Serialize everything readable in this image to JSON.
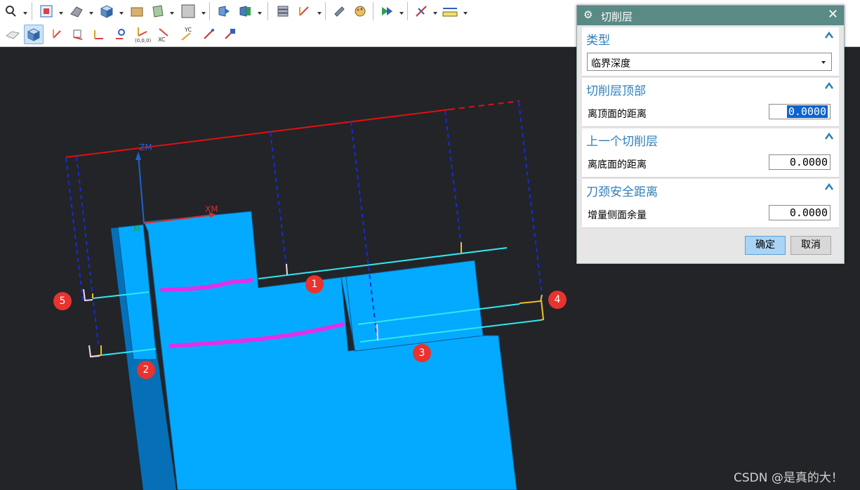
{
  "toolbar": {
    "row1_icons": [
      "magnifier-icon",
      "fit-view-icon",
      "shaded-view-icon",
      "solid-cube-icon",
      "folder-icon",
      "sheet-icon",
      "blank-square-icon",
      "orient-view-icon",
      "section-view-icon",
      "layers-icon",
      "wcs-icon",
      "tool-icon",
      "palette-icon",
      "display-icon",
      "arrange-icon",
      "measure-icon"
    ],
    "row2_icons": [
      "static-wireframe-icon",
      "shaded-cube-icon",
      "wcs-origin-icon",
      "wcs-dynamic-icon",
      "axis-icon",
      "rotate-wcs-icon",
      "origin-point-icon",
      "xc-axis-icon",
      "yc-axis-icon",
      "orient-wcs-icon",
      "save-wcs-icon"
    ]
  },
  "viewport": {
    "axis_labels": {
      "zm": "ZM",
      "xm": "XM",
      "m": "M"
    },
    "badges": [
      "1",
      "2",
      "3",
      "4",
      "5"
    ]
  },
  "dialog": {
    "title": "切削层",
    "sections": {
      "type": {
        "header": "类型",
        "value": "临界深度"
      },
      "top": {
        "header": "切削层顶部",
        "label": "离顶面的距离",
        "value": "0.0000"
      },
      "prev": {
        "header": "上一个切削层",
        "label": "离底面的距离",
        "value": "0.0000"
      },
      "neck": {
        "header": "刀颈安全距离",
        "label": "增量侧面余量",
        "value": "0.0000"
      }
    },
    "ok": "确定",
    "cancel": "取消"
  },
  "colors": {
    "title_bar": "#5a8a85",
    "section_header": "#2e7fb8",
    "part_face": "#04aaff",
    "part_side": "#0570b8",
    "red_line": "#e01010",
    "cyan_line": "#30e8f0",
    "magenta_line": "#e030e8",
    "projection_blue": "#1a2ad8",
    "yellow": "#f0c020"
  },
  "watermark": "CSDN @是真的大！"
}
